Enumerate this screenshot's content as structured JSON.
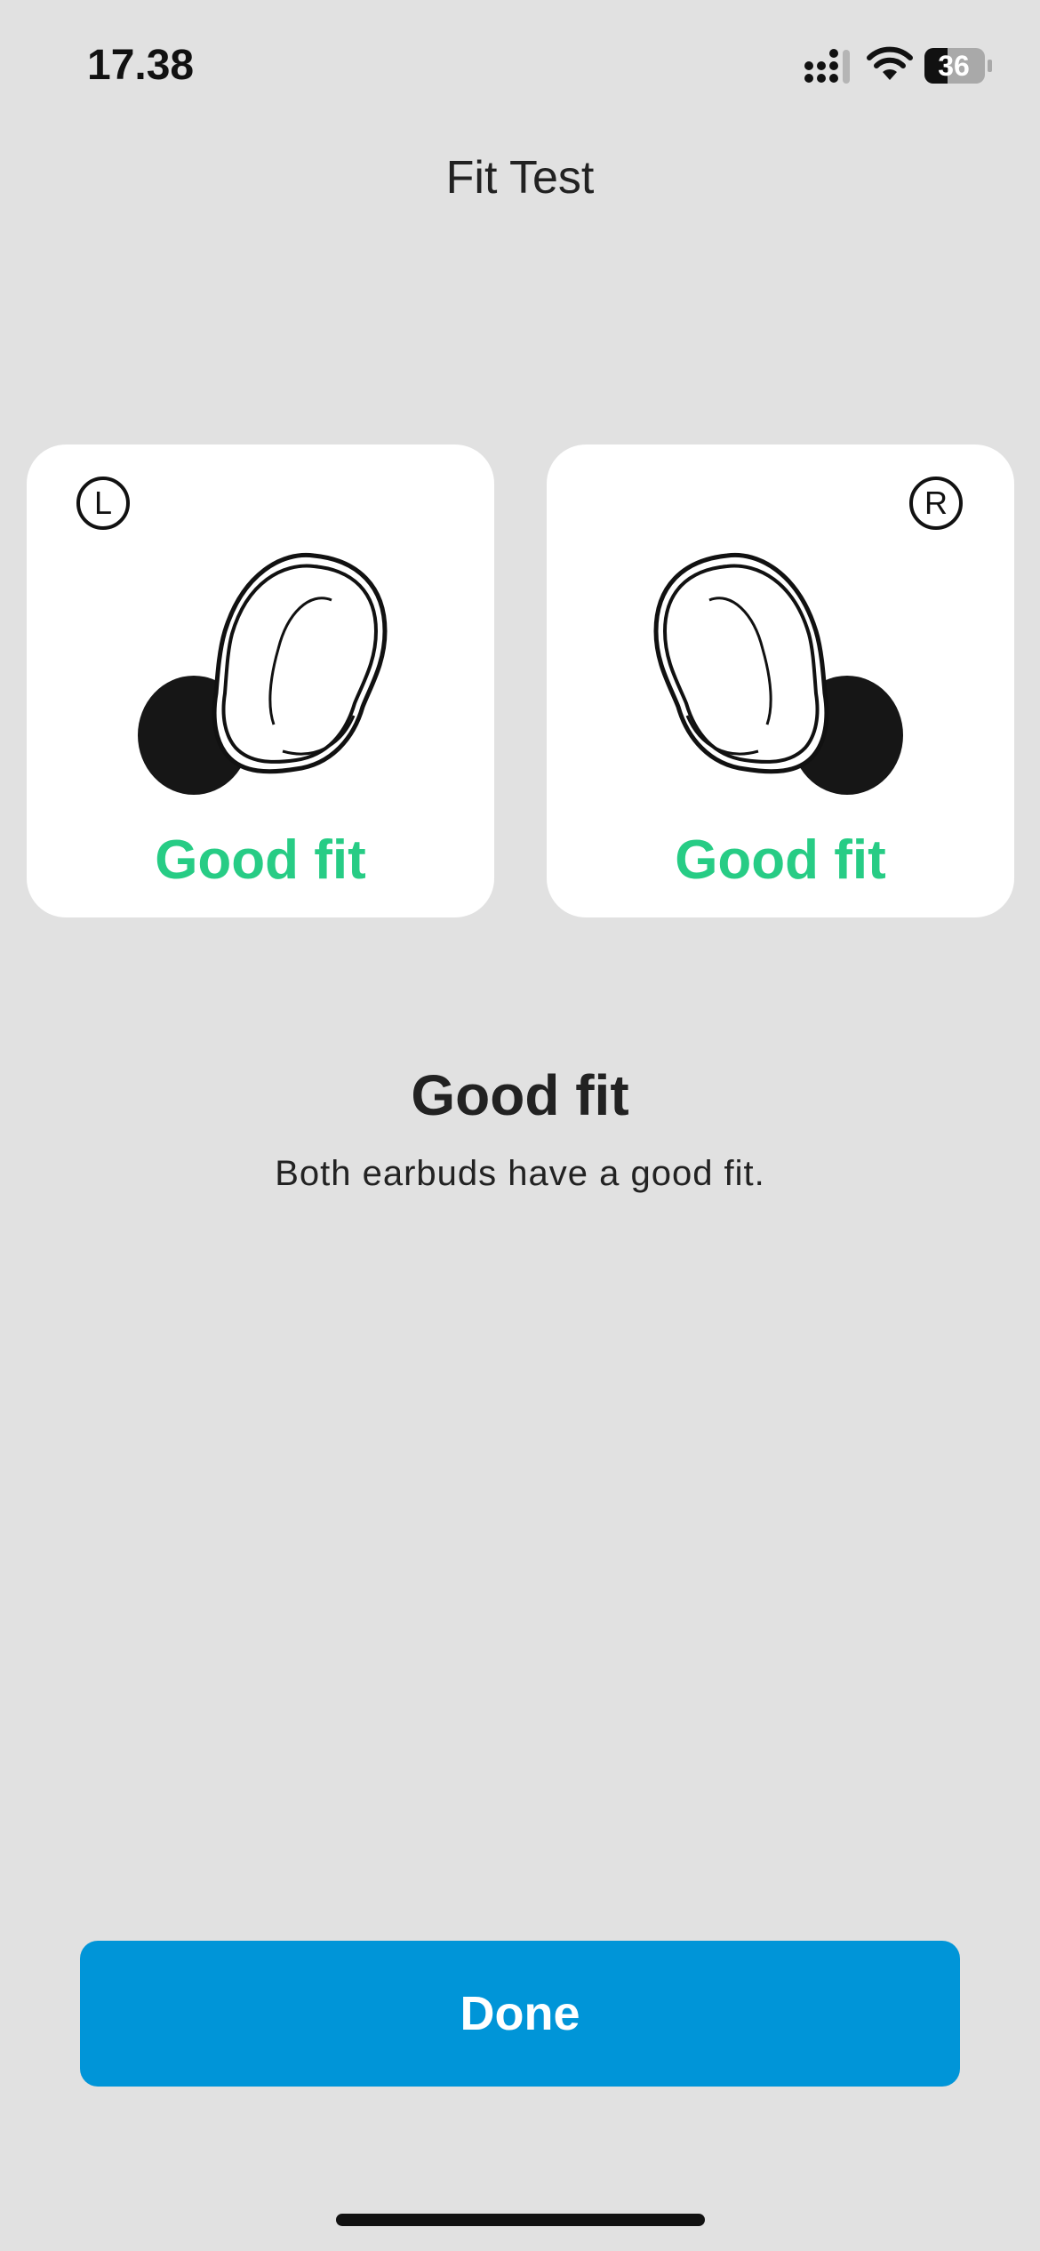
{
  "status_bar": {
    "time": "17.38",
    "battery_level": "36",
    "icons": [
      "signal-icon",
      "wifi-icon",
      "battery-icon"
    ]
  },
  "header": {
    "title": "Fit Test"
  },
  "earbuds": [
    {
      "side_label": "L",
      "status": "Good fit",
      "icon": "left-earbud-icon"
    },
    {
      "side_label": "R",
      "status": "Good fit",
      "icon": "right-earbud-icon"
    }
  ],
  "result": {
    "title": "Good fit",
    "description": "Both earbuds have a good fit."
  },
  "actions": {
    "done_label": "Done"
  },
  "colors": {
    "background": "#e1e1e1",
    "card": "#ffffff",
    "good_fit": "#27cc85",
    "primary_button": "#0095d8"
  }
}
